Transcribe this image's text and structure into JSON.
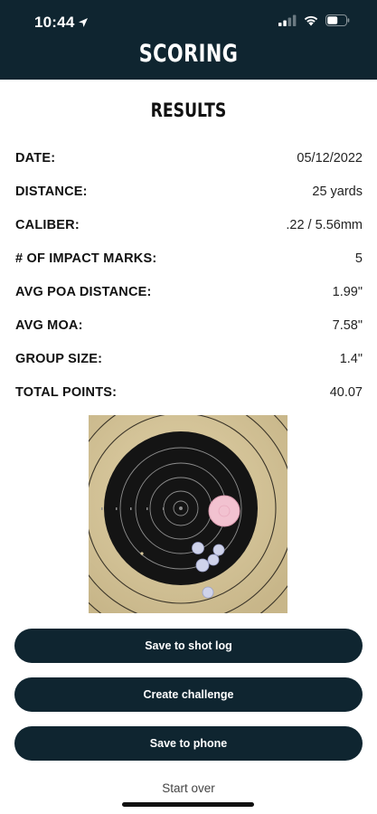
{
  "status_bar": {
    "time": "10:44",
    "icons": [
      "location-arrow-icon",
      "signal-icon",
      "wifi-icon",
      "battery-icon"
    ]
  },
  "header": {
    "title": "SCORING"
  },
  "results": {
    "title": "RESULTS",
    "rows": [
      {
        "label": "DATE:",
        "value": "05/12/2022"
      },
      {
        "label": "DISTANCE:",
        "value": "25 yards"
      },
      {
        "label": "CALIBER:",
        "value": ".22 / 5.56mm"
      },
      {
        "label": "# OF IMPACT MARKS:",
        "value": "5"
      },
      {
        "label": "AVG POA DISTANCE:",
        "value": "1.99\""
      },
      {
        "label": "AVG MOA:",
        "value": "7.58\""
      },
      {
        "label": "GROUP SIZE:",
        "value": "1.4\""
      },
      {
        "label": "TOTAL POINTS:",
        "value": "40.07"
      }
    ]
  },
  "buttons": {
    "save_log": "Save to shot log",
    "challenge": "Create challenge",
    "save_phone": "Save to phone",
    "start_over": "Start over"
  },
  "colors": {
    "header_bg": "#0f2530",
    "button_bg": "#0f2530",
    "target_paper": "#d8c79a",
    "target_black": "#141414",
    "poa_marker": "#f2c2d0"
  }
}
